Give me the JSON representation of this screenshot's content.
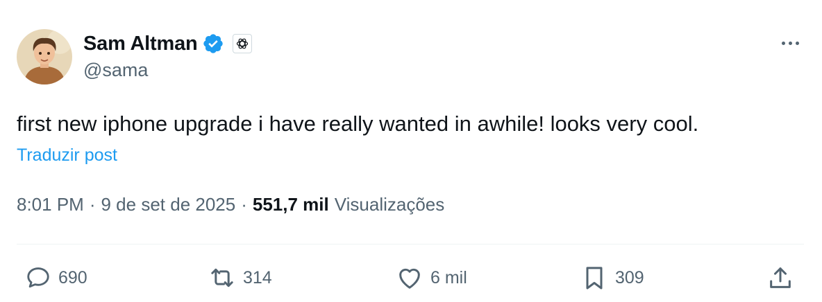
{
  "author": {
    "display_name": "Sam Altman",
    "handle": "@sama",
    "verified": true,
    "verified_color": "#1d9bf0",
    "affiliate_icon": "openai-logo-icon"
  },
  "post": {
    "text": "first new iphone upgrade i have really wanted in awhile! looks very cool.",
    "translate_label": "Traduzir post"
  },
  "meta": {
    "time": "8:01 PM",
    "separator": "·",
    "date": "9 de set de 2025",
    "views_count": "551,7 mil",
    "views_label": "Visualizações"
  },
  "actions": {
    "reply": {
      "icon": "reply-icon",
      "count": "690"
    },
    "repost": {
      "icon": "repost-icon",
      "count": "314"
    },
    "like": {
      "icon": "heart-icon",
      "count": "6 mil"
    },
    "bookmark": {
      "icon": "bookmark-icon",
      "count": "309"
    },
    "share": {
      "icon": "share-icon"
    }
  },
  "colors": {
    "text_primary": "#0f1419",
    "text_secondary": "#536471",
    "link": "#1d9bf0",
    "divider": "#eff3f4"
  }
}
